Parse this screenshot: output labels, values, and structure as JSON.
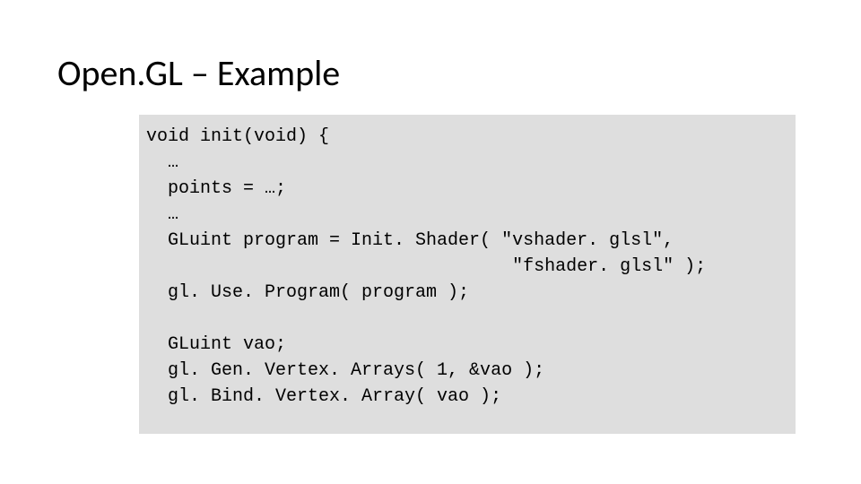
{
  "slide": {
    "title": "Open.GL – Example",
    "code": "void init(void) {\n  …\n  points = …;\n  …\n  GLuint program = Init. Shader( \"vshader. glsl\",\n                                  \"fshader. glsl\" );\n  gl. Use. Program( program );\n\n  GLuint vao;\n  gl. Gen. Vertex. Arrays( 1, &vao );\n  gl. Bind. Vertex. Array( vao );"
  }
}
